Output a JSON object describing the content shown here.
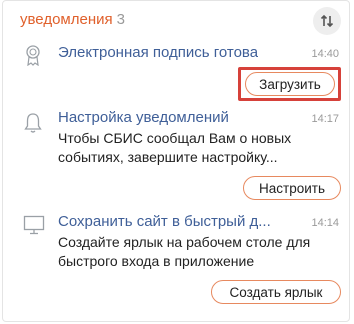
{
  "header": {
    "title": "уведомления",
    "count": "3",
    "sort_icon": "sort-arrows-icon"
  },
  "notifications": [
    {
      "icon": "certificate-icon",
      "title": "Электронная подпись готова",
      "time": "14:40",
      "description": "",
      "action": "Загрузить",
      "action_highlighted": true
    },
    {
      "icon": "bell-icon",
      "title": "Настройка уведомлений",
      "time": "14:17",
      "description": "Чтобы СБИС сообщал Вам о новых событиях, завершите настройку...",
      "action": "Настроить"
    },
    {
      "icon": "monitor-icon",
      "title": "Сохранить сайт в быстрый д...",
      "time": "14:14",
      "description": "Создайте ярлык на рабочем столе для быстрого входа в приложение",
      "action": "Создать ярлык"
    }
  ],
  "colors": {
    "accent": "#e0602b",
    "link": "#3f5f98",
    "highlight": "#d6413a"
  }
}
